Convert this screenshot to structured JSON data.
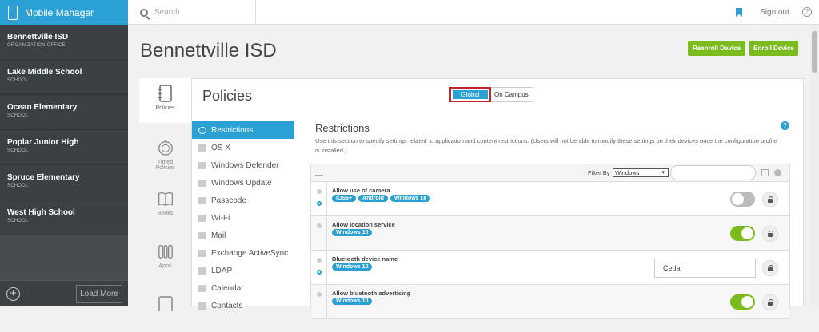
{
  "app": {
    "title": "Mobile Manager"
  },
  "search": {
    "placeholder": "Search"
  },
  "header": {
    "signout": "Sign out",
    "help": "?"
  },
  "sidebar": {
    "items": [
      {
        "name": "Bennettville ISD",
        "type": "ORGANIZATION OFFICE"
      },
      {
        "name": "Lake Middle School",
        "type": "SCHOOL"
      },
      {
        "name": "Ocean Elementary",
        "type": "SCHOOL"
      },
      {
        "name": "Poplar Junior High",
        "type": "SCHOOL"
      },
      {
        "name": "Spruce Elementary",
        "type": "SCHOOL"
      },
      {
        "name": "West High School",
        "type": "SCHOOL"
      }
    ],
    "add": "+",
    "load_more": "Load More"
  },
  "main": {
    "title": "Bennettville ISD",
    "reenroll": "Reenroll Device",
    "enroll": "Enroll Device"
  },
  "vtabs": [
    "Policies",
    "Timed Policies",
    "Books",
    "Apps"
  ],
  "policies": {
    "title": "Policies",
    "scope": {
      "global": "Global",
      "campus": "On Campus"
    }
  },
  "menu": [
    "Restrictions",
    "OS X",
    "Windows Defender",
    "Windows Update",
    "Passcode",
    "Wi-Fi",
    "Mail",
    "Exchange ActiveSync",
    "LDAP",
    "Calendar",
    "Contacts"
  ],
  "restrictions": {
    "title": "Restrictions",
    "desc": "Use this section to specify settings related to application and content restrictions. (Users will not be able to modify these settings on their devices once the configuration profile is installed.)",
    "help": "?",
    "filter_label": "Filter By",
    "filter_value": "Windows",
    "rows": [
      {
        "label": "Allow use of camera",
        "badges": [
          "IOS6+",
          "Android",
          "Windows 10"
        ],
        "control": "switch",
        "state": "off"
      },
      {
        "label": "Allow location service",
        "badges": [
          "Windows 10"
        ],
        "control": "switch",
        "state": "on"
      },
      {
        "label": "Bluetooth device name",
        "badges": [
          "Windows 10"
        ],
        "control": "text",
        "value": "Cedar"
      },
      {
        "label": "Allow bluetooth advertising",
        "badges": [
          "Windows 10"
        ],
        "control": "switch",
        "state": "on"
      }
    ]
  },
  "colors": {
    "accent": "#2aa0d4",
    "green": "#7cbb1d",
    "sidebar": "#3b4044",
    "highlight": "#c0272d"
  }
}
